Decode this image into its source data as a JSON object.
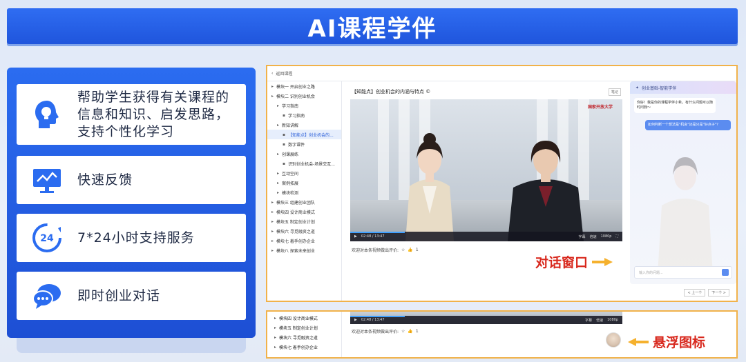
{
  "banner": {
    "title": "AI课程学伴"
  },
  "features": [
    {
      "icon": "head-bulb-icon",
      "lines": [
        "帮助学生获得有关课程的",
        "信息和知识、启发思路，",
        "支持个性化学习"
      ]
    },
    {
      "icon": "monitor-chart-icon",
      "lines": [
        "快速反馈"
      ]
    },
    {
      "icon": "clock-24-icon",
      "lines": [
        "7*24小时支持服务"
      ]
    },
    {
      "icon": "chat-bubble-icon",
      "lines": [
        "即时创业对话"
      ]
    }
  ],
  "screen": {
    "back_label": "返回课程",
    "nav_items": [
      {
        "label": "模块一 开启创业之路",
        "level": 0
      },
      {
        "label": "模块二 识别创业机会",
        "level": 0
      },
      {
        "label": "学习指南",
        "level": 1
      },
      {
        "label": "学习指南",
        "level": 2
      },
      {
        "label": "新知讲解",
        "level": 1
      },
      {
        "label": "【知能点】创业机会的...",
        "level": 2,
        "active": true
      },
      {
        "label": "数字课件",
        "level": 2
      },
      {
        "label": "创课展练",
        "level": 1
      },
      {
        "label": "识别创业机会-场景交互...",
        "level": 2
      },
      {
        "label": "互动空间",
        "level": 1
      },
      {
        "label": "案例拓展",
        "level": 1
      },
      {
        "label": "模块检测",
        "level": 1
      },
      {
        "label": "模块三 组建创业团队",
        "level": 0
      },
      {
        "label": "模块四 设计商业模式",
        "level": 0
      },
      {
        "label": "模块五 制定创业计划",
        "level": 0
      },
      {
        "label": "模块六 寻觅融资之道",
        "level": 0
      },
      {
        "label": "模块七 着手创办企业",
        "level": 0
      },
      {
        "label": "模块八 探索未来创业",
        "level": 0
      }
    ],
    "lesson_title": "【知能点】创业机会的内涵与特点 ©",
    "lesson_tag": "笔记",
    "video_logo": "国家开放大学",
    "video_time": "02:48 / 13:47",
    "video_progress": 0.2,
    "video_controls": [
      "字幕",
      "倍速",
      "1080p"
    ],
    "rating_prompt": "欢迎对本条视频做出评价:",
    "like_count": "1",
    "chat_title": "创业基础-智能学伴",
    "chat_bot_msg": "你好！我是你的课程学伴小希，有什么问题可以随时问我～",
    "chat_user_msg": "如何判断一个想法是\"机会\"还是只是\"好点子\"？",
    "chat_placeholder": "输入你的问题...",
    "pager": [
      "< 上一个",
      "下一个 >"
    ]
  },
  "callouts": {
    "dialog_window": "对话窗口",
    "floating_icon": "悬浮图标"
  },
  "strip": {
    "nav_items": [
      "模块四 设计商业模式",
      "模块五 制定创业计划",
      "模块六 寻觅融资之道",
      "模块七 着手创办企业"
    ],
    "video_time": "02:48 / 13:47",
    "rating_prompt": "欢迎对本条视频做出评价:",
    "like_count": "1"
  },
  "colors": {
    "brand_blue": "#2b6cf0",
    "accent_orange": "#f1b24a",
    "callout_red": "#d8281d"
  }
}
